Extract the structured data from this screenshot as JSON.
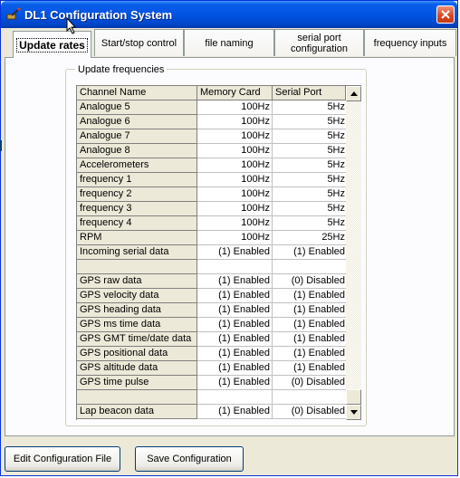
{
  "window": {
    "title": "DL1 Configuration System"
  },
  "tabs": [
    {
      "label": "Update rates",
      "active": true
    },
    {
      "label": "Start/stop control",
      "active": false
    },
    {
      "label": "file naming",
      "active": false
    },
    {
      "label": "serial port configuration",
      "active": false
    },
    {
      "label": "frequency inputs",
      "active": false
    }
  ],
  "group": {
    "legend": "Update frequencies"
  },
  "grid": {
    "columns": [
      "Channel Name",
      "Memory Card",
      "Serial Port"
    ],
    "rows": [
      {
        "name": "Analogue 5",
        "memory": "100Hz",
        "serial": "5Hz"
      },
      {
        "name": "Analogue 6",
        "memory": "100Hz",
        "serial": "5Hz"
      },
      {
        "name": "Analogue 7",
        "memory": "100Hz",
        "serial": "5Hz"
      },
      {
        "name": "Analogue 8",
        "memory": "100Hz",
        "serial": "5Hz"
      },
      {
        "name": "Accelerometers",
        "memory": "100Hz",
        "serial": "5Hz"
      },
      {
        "name": "frequency 1",
        "memory": "100Hz",
        "serial": "5Hz"
      },
      {
        "name": "frequency 2",
        "memory": "100Hz",
        "serial": "5Hz"
      },
      {
        "name": "frequency 3",
        "memory": "100Hz",
        "serial": "5Hz"
      },
      {
        "name": "frequency 4",
        "memory": "100Hz",
        "serial": "5Hz"
      },
      {
        "name": "RPM",
        "memory": "100Hz",
        "serial": "25Hz"
      },
      {
        "name": "Incoming serial data",
        "memory": "(1) Enabled",
        "serial": "(1) Enabled"
      },
      {
        "name": "",
        "memory": "",
        "serial": ""
      },
      {
        "name": "GPS raw data",
        "memory": "(1) Enabled",
        "serial": "(0) Disabled"
      },
      {
        "name": "GPS velocity data",
        "memory": "(1) Enabled",
        "serial": "(1) Enabled"
      },
      {
        "name": "GPS heading data",
        "memory": "(1) Enabled",
        "serial": "(1) Enabled"
      },
      {
        "name": "GPS ms time data",
        "memory": "(1) Enabled",
        "serial": "(1) Enabled"
      },
      {
        "name": "GPS GMT time/date data",
        "memory": "(1) Enabled",
        "serial": "(1) Enabled"
      },
      {
        "name": "GPS positional data",
        "memory": "(1) Enabled",
        "serial": "(1) Enabled"
      },
      {
        "name": "GPS altitude data",
        "memory": "(1) Enabled",
        "serial": "(1) Enabled"
      },
      {
        "name": "GPS time pulse",
        "memory": "(1) Enabled",
        "serial": "(0) Disabled"
      },
      {
        "name": "",
        "memory": "",
        "serial": ""
      },
      {
        "name": "Lap beacon data",
        "memory": "(1) Enabled",
        "serial": "(0) Disabled"
      }
    ]
  },
  "buttons": {
    "edit_config": "Edit Configuration File",
    "save_config": "Save Configuration"
  },
  "colors": {
    "title_bar": "#0054e3",
    "face": "#ece9d8",
    "close": "#d9431c"
  },
  "icons": [
    "app-icon",
    "close-icon",
    "scroll-up-icon",
    "scroll-down-icon",
    "mouse-cursor-icon"
  ]
}
